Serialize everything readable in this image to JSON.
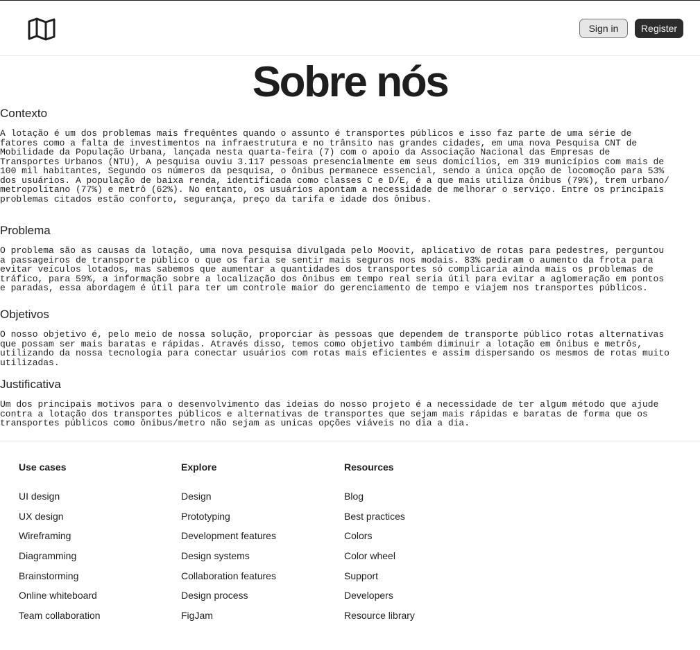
{
  "header": {
    "logo_icon": "map-icon",
    "sign_in_label": "Sign in",
    "register_label": "Register"
  },
  "page": {
    "title": "Sobre nós"
  },
  "sections": [
    {
      "heading": "Contexto",
      "body": "A lotação é um dos problemas mais frequêntes quando o assunto é transportes públicos e isso faz parte de uma série de\nfatores como a falta de investimentos na infraestrutura e no trânsito nas grandes cidades, em uma nova Pesquisa CNT de\nMobilidade da População Urbana, lançada nesta quarta-feira (7) com o apoio da Associação Nacional das Empresas de\nTransportes Urbanos (NTU), A pesquisa ouviu 3.117 pessoas presencialmente em seus domicílios, em 319 municípios com mais de\n100 mil habitantes, Segundo os números da pesquisa, o ônibus permanece essencial, sendo a única opção de locomoção para 53%\ndos usuários. A população de baixa renda, identificada como classes C e D/E, é a que mais utiliza ônibus (79%), trem urbano/\nmetropolitano (77%) e metrô (62%). No entanto, os usuários apontam a necessidade de melhorar o serviço. Entre os principais\nproblemas citados estão conforto, segurança, preço da tarifa e idade dos ônibus."
    },
    {
      "heading": "Problema",
      "body": "O problema são as causas da lotação, uma nova pesquisa divulgada pelo Moovit, aplicativo de rotas para pedestres, perguntou\na passageiros de transporte público o que os faria se sentir mais seguros nos modais. 83% pediram o aumento da frota para\nevitar veículos lotados, mas sabemos que aumentar a quantidades dos transportes só complicaria ainda mais os problemas de\ntráfico, para 59%, a informação sobre a localização dos ônibus em tempo real seria útil para evitar a aglomeração em pontos\ne paradas, essa abordagem é útil para ter um controle maior do gerenciamento de tempo e viajem nos transportes públicos."
    },
    {
      "heading": "Objetivos",
      "body": "O nosso objetivo é, pelo meio de nossa solução, proporciar às pessoas que dependem de transporte público rotas alternativas\nque possam ser mais baratas e rápidas. Através disso, temos como objetivo também diminuir a lotação em ônibus e metrôs,\nutilizando da nossa tecnologia para conectar usuários com rotas mais eficientes e assim dispersando os mesmos de rotas muito\nutilizadas."
    },
    {
      "heading": "Justificativa",
      "body": "Um dos principais motivos para o desenvolvimento das ideias do nosso projeto é a necessidade de ter algum método que ajude\ncontra a lotação dos transportes públicos e alternativas de transportes que sejam mais rápidas e baratas de forma que os\ntransportes públicos como ônibus/metro não sejam as unicas opções viáveis no dia a dia."
    }
  ],
  "footer": {
    "columns": [
      {
        "title": "Use cases",
        "links": [
          "UI design",
          "UX design",
          "Wireframing",
          "Diagramming",
          "Brainstorming",
          "Online whiteboard",
          "Team collaboration"
        ]
      },
      {
        "title": "Explore",
        "links": [
          "Design",
          "Prototyping",
          "Development features",
          "Design systems",
          "Collaboration features",
          "Design process",
          "FigJam"
        ]
      },
      {
        "title": "Resources",
        "links": [
          "Blog",
          "Best practices",
          "Colors",
          "Color wheel",
          "Support",
          "Developers",
          "Resource library"
        ]
      }
    ]
  }
}
